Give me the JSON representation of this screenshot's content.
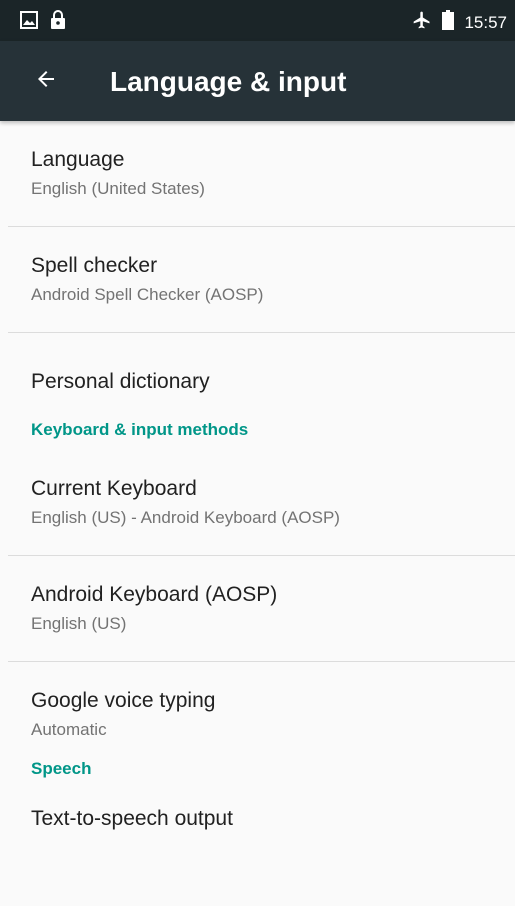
{
  "status_bar": {
    "time": "15:57",
    "icons_left": [
      "image-icon",
      "lock-icon"
    ],
    "icons_right": [
      "airplane-icon",
      "battery-icon"
    ]
  },
  "app_bar": {
    "title": "Language & input",
    "back_icon": "arrow-back-icon"
  },
  "items": {
    "language": {
      "title": "Language",
      "summary": "English (United States)"
    },
    "spell_checker": {
      "title": "Spell checker",
      "summary": "Android Spell Checker (AOSP)"
    },
    "personal_dictionary": {
      "title": "Personal dictionary"
    },
    "keyboard_header": "Keyboard & input methods",
    "current_keyboard": {
      "title": "Current Keyboard",
      "summary": "English (US) - Android Keyboard (AOSP)"
    },
    "android_keyboard": {
      "title": "Android Keyboard (AOSP)",
      "summary": "English (US)"
    },
    "google_voice": {
      "title": "Google voice typing",
      "summary": "Automatic"
    },
    "speech_header": "Speech",
    "tts": {
      "title": "Text-to-speech output"
    }
  },
  "colors": {
    "app_bar": "#263238",
    "status_bar": "#1b2528",
    "accent": "#009688",
    "background": "#fafafa"
  }
}
